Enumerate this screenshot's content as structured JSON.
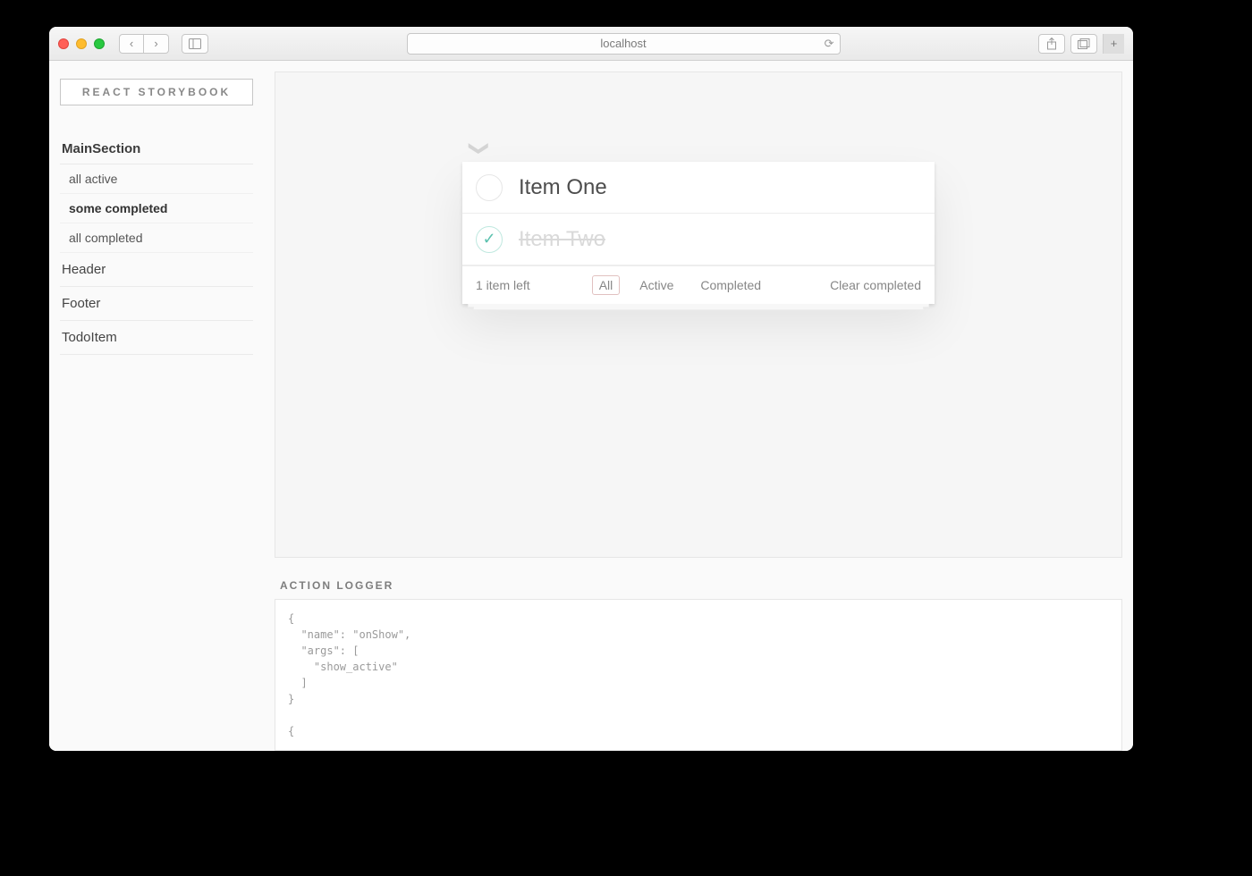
{
  "browser": {
    "address": "localhost"
  },
  "sidebar": {
    "brand": "REACT STORYBOOK",
    "section": "MainSection",
    "stories": [
      {
        "label": "all active",
        "selected": false
      },
      {
        "label": "some completed",
        "selected": true
      },
      {
        "label": "all completed",
        "selected": false
      }
    ],
    "groups": [
      "Header",
      "Footer",
      "TodoItem"
    ]
  },
  "todo": {
    "items": [
      {
        "label": "Item One",
        "completed": false
      },
      {
        "label": "Item Two",
        "completed": true
      }
    ],
    "count_text": "1 item left",
    "filters": {
      "all": "All",
      "active": "Active",
      "completed": "Completed"
    },
    "active_filter": "all",
    "clear": "Clear completed"
  },
  "logger": {
    "title": "ACTION LOGGER",
    "content": "{\n  \"name\": \"onShow\",\n  \"args\": [\n    \"show_active\"\n  ]\n}\n\n{"
  }
}
